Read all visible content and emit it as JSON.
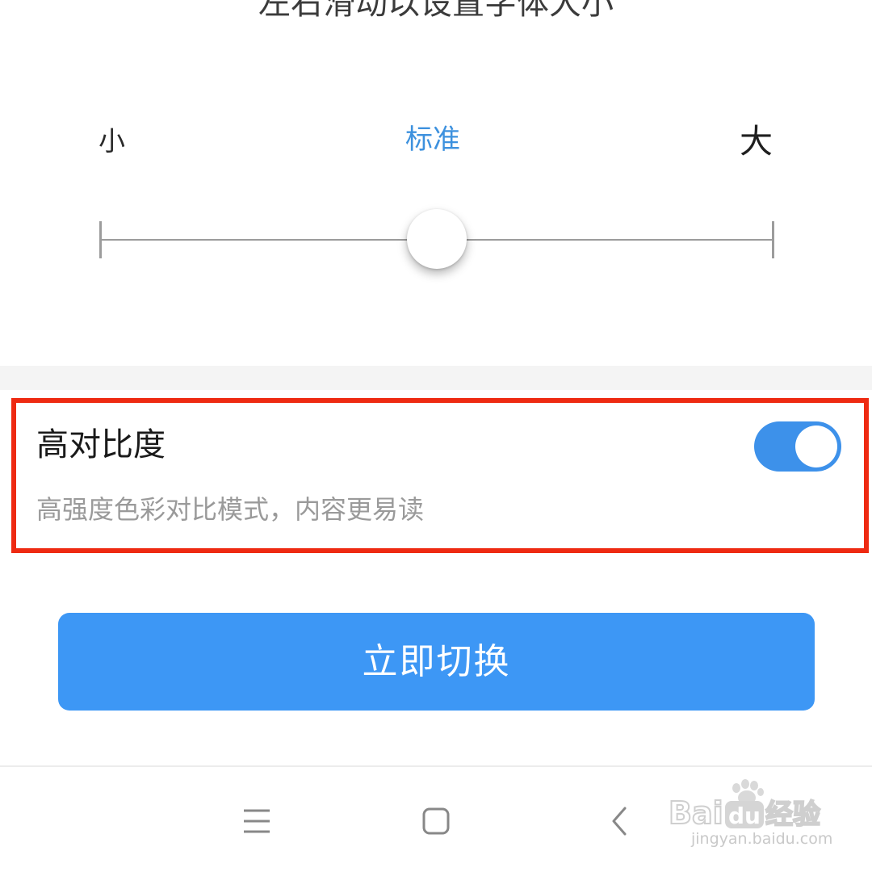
{
  "header": {
    "instruction": "左右滑动以设置字体大小"
  },
  "font_size": {
    "small_label": "小",
    "standard_label": "标准",
    "large_label": "大",
    "slider": {
      "steps": 3,
      "selected_index": 1,
      "fraction": 0.5
    }
  },
  "high_contrast": {
    "title": "高对比度",
    "description": "高强度色彩对比模式，内容更易读",
    "enabled": true,
    "highlighted": true
  },
  "actions": {
    "apply_label": "立即切换"
  },
  "nav": {
    "menu_icon": "menu-icon",
    "home_icon": "home-icon",
    "back_icon": "back-icon"
  },
  "watermark": {
    "brand": "Baidu经验",
    "url": "jingyan.baidu.com"
  },
  "colors": {
    "accent": "#3d91de",
    "button": "#3d97f5",
    "toggle_on": "#3d91ea",
    "highlight": "#ee2a12"
  }
}
